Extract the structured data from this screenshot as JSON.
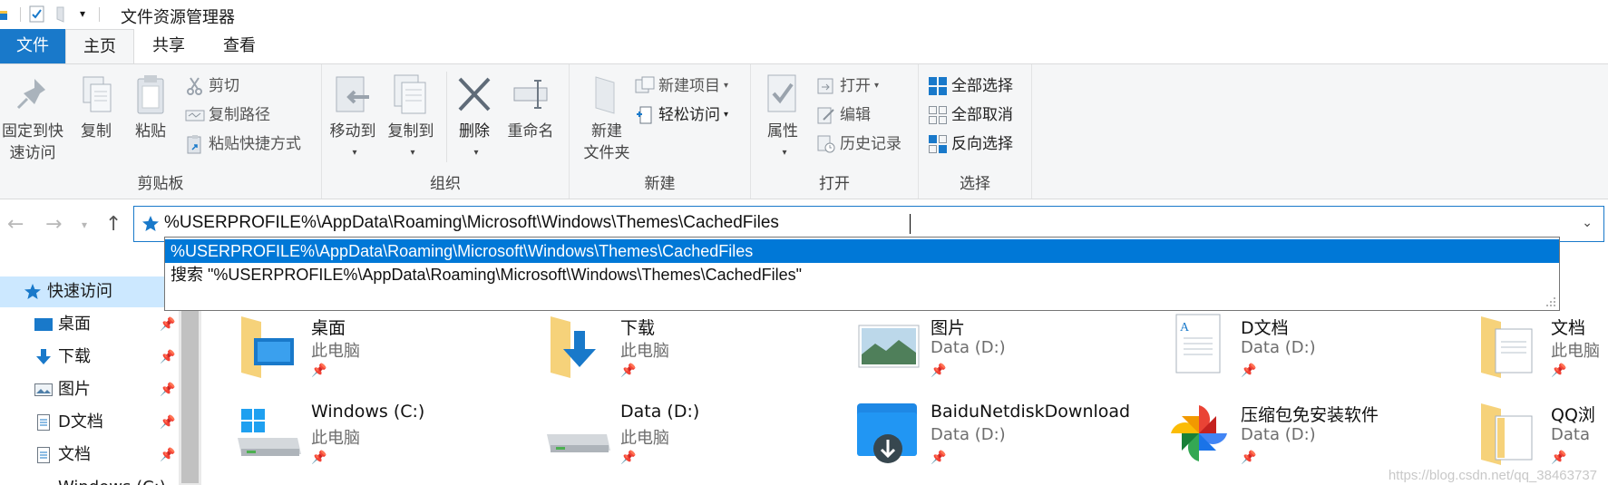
{
  "window": {
    "title": "文件资源管理器"
  },
  "tabs": {
    "file": "文件",
    "home": "主页",
    "share": "共享",
    "view": "查看"
  },
  "ribbon": {
    "clipboard": {
      "label": "剪贴板",
      "pin_line1": "固定到快",
      "pin_line2": "速访问",
      "copy": "复制",
      "paste": "粘贴",
      "cut": "剪切",
      "copy_path": "复制路径",
      "paste_shortcut": "粘贴快捷方式"
    },
    "organize": {
      "label": "组织",
      "move_to": "移动到",
      "copy_to": "复制到",
      "delete": "删除",
      "rename": "重命名"
    },
    "new": {
      "label": "新建",
      "new_folder_line1": "新建",
      "new_folder_line2": "文件夹",
      "new_item": "新建项目",
      "easy_access": "轻松访问"
    },
    "open": {
      "label": "打开",
      "properties": "属性",
      "open": "打开",
      "edit": "编辑",
      "history": "历史记录"
    },
    "select": {
      "label": "选择",
      "select_all": "全部选择",
      "select_none": "全部取消",
      "invert": "反向选择"
    }
  },
  "address": {
    "value": "%USERPROFILE%\\AppData\\Roaming\\Microsoft\\Windows\\Themes\\CachedFiles",
    "suggestions": [
      "%USERPROFILE%\\AppData\\Roaming\\Microsoft\\Windows\\Themes\\CachedFiles",
      "搜索 \"%USERPROFILE%\\AppData\\Roaming\\Microsoft\\Windows\\Themes\\CachedFiles\""
    ]
  },
  "nav_pane": {
    "items": [
      {
        "label": "快速访问",
        "icon": "star-icon"
      },
      {
        "label": "桌面",
        "icon": "desktop-icon"
      },
      {
        "label": "下载",
        "icon": "download-icon"
      },
      {
        "label": "图片",
        "icon": "pictures-icon"
      },
      {
        "label": "D文档",
        "icon": "document-icon"
      },
      {
        "label": "文档",
        "icon": "document-icon"
      },
      {
        "label": "Windows (C:)",
        "icon": "drive-icon"
      }
    ]
  },
  "tiles": [
    {
      "name": "桌面",
      "sub": "此电脑",
      "icon": "desktop-folder-icon"
    },
    {
      "name": "下载",
      "sub": "此电脑",
      "icon": "download-folder-icon"
    },
    {
      "name": "图片",
      "sub": "Data (D:)",
      "icon": "pictures-icon"
    },
    {
      "name": "D文档",
      "sub": "Data (D:)",
      "icon": "document-icon"
    },
    {
      "name": "文档",
      "sub": "此电脑",
      "icon": "documents-folder-icon"
    },
    {
      "name": "Windows (C:)",
      "sub": "此电脑",
      "icon": "windows-drive-icon"
    },
    {
      "name": "Data (D:)",
      "sub": "此电脑",
      "icon": "drive-icon"
    },
    {
      "name": "BaiduNetdiskDownload",
      "sub": "Data (D:)",
      "icon": "download-folder-icon"
    },
    {
      "name": "压缩包免安装软件",
      "sub": "Data (D:)",
      "icon": "pinwheel-icon"
    },
    {
      "name": "QQ浏",
      "sub": "Data",
      "icon": "folder-icon"
    }
  ],
  "pin_glyph": "📌",
  "watermark": "https://blog.csdn.net/qq_38463737",
  "colors": {
    "accent": "#1979ca",
    "selection": "#0078d7",
    "nav_highlight": "#cce8ff"
  }
}
